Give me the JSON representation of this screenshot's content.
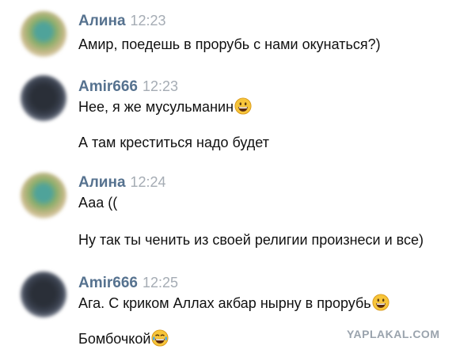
{
  "messages": [
    {
      "author": "Алина",
      "time": "12:23",
      "lines": [
        "Амир, поедешь в прорубь с нами окунаться?)"
      ]
    },
    {
      "author": "Amir666",
      "time": "12:23",
      "lines": [
        "Нее, я же мусульманин",
        "А там креститься надо будет"
      ],
      "emojis": [
        "grinning-emoji"
      ]
    },
    {
      "author": "Алина",
      "time": "12:24",
      "lines": [
        "Ааа ((",
        "Ну так ты ченить из своей религии произнеси и все)"
      ]
    },
    {
      "author": "Amir666",
      "time": "12:25",
      "lines": [
        "Ага. С криком Аллах акбар нырну в прорубь",
        "Бомбочкой"
      ],
      "emojis": [
        "grinning-emoji",
        "tears-of-joy-emoji"
      ]
    }
  ],
  "watermark": "YAPLAKAL.COM",
  "colors": {
    "author": "#56728f",
    "time": "#a5acb4",
    "text": "#111111"
  }
}
